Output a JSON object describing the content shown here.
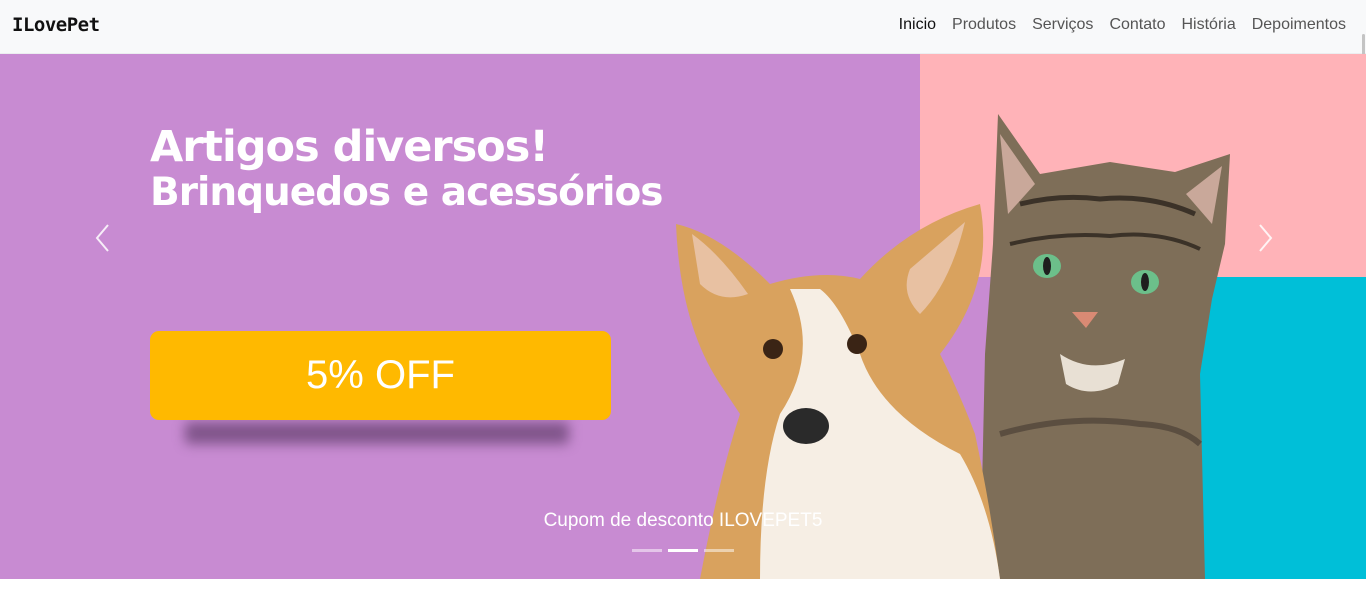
{
  "brand": "ILovePet",
  "nav": {
    "items": [
      "Inicio",
      "Produtos",
      "Serviços",
      "Contato",
      "História",
      "Depoimentos"
    ],
    "active": "Inicio"
  },
  "hero": {
    "headline_line1": "Artigos diversos!",
    "headline_line2": "Brinquedos e acessórios",
    "offer": "5% OFF",
    "caption": "Cupom de desconto ILOVEPET5",
    "slide_count": 3,
    "active_slide": 2,
    "colors": {
      "background": "#c88bd2",
      "panel_pink": "#ffb3b8",
      "panel_cyan": "#00bfd8",
      "button": "#ffb900"
    }
  },
  "icons": {
    "prev": "chevron-left-icon",
    "next": "chevron-right-icon"
  }
}
